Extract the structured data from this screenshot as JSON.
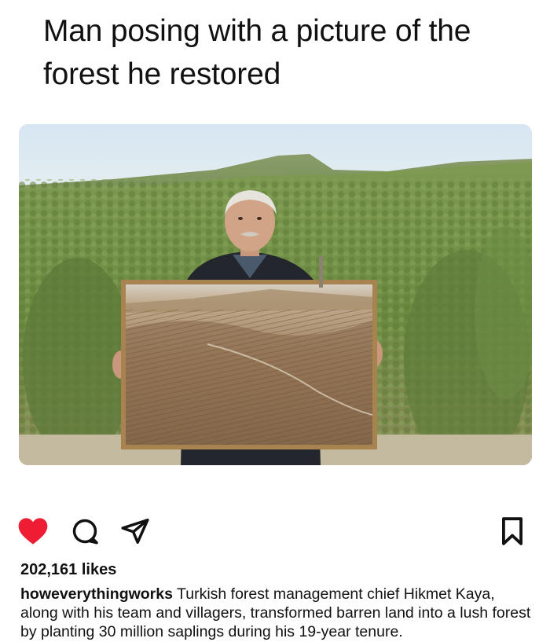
{
  "meme": {
    "title": "Man posing with a picture of the forest he restored"
  },
  "photo": {
    "description_icon": "photo-of-man-holding-framed-picture"
  },
  "actions": {
    "like_icon": "heart-icon",
    "like_color": "#ee1d34",
    "comment_icon": "comment-icon",
    "share_icon": "send-icon",
    "save_icon": "bookmark-icon"
  },
  "post": {
    "likes": "202,161 likes",
    "username": "howeverythingworks",
    "caption": "Turkish forest management chief Hikmet Kaya, along with his team and villagers, transformed barren land into a lush forest by planting 30 million saplings during his 19-year tenure."
  }
}
